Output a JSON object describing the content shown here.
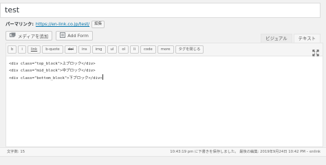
{
  "title": {
    "value": "test"
  },
  "permalink": {
    "label": "パーマリンク:",
    "url": "https://en-link.co.jp/test/",
    "edit_label": "編集"
  },
  "media": {
    "add_media_label": "メディアを追加",
    "add_form_label": "Add Form"
  },
  "tabs": [
    {
      "label": "ビジュアル"
    },
    {
      "label": "テキスト",
      "active": true
    }
  ],
  "quicktags": [
    {
      "label": "b"
    },
    {
      "label": "i"
    },
    {
      "label": "link"
    },
    {
      "label": "b-quote"
    },
    {
      "label": "del"
    },
    {
      "label": "ins"
    },
    {
      "label": "img"
    },
    {
      "label": "ul"
    },
    {
      "label": "ol"
    },
    {
      "label": "li"
    },
    {
      "label": "code"
    },
    {
      "label": "more"
    },
    {
      "label": "タグを閉じる"
    }
  ],
  "content": {
    "lines": [
      "<div class=\"top_block\">上ブロック</div>",
      "<div class=\"mid_block\">中ブロック</div>",
      "<div class=\"bottom_block\">下ブロック</div>"
    ]
  },
  "status": {
    "word_count": "文字数: 15",
    "saved_text": "10:43:19 pm に下書きを保存しました。 最後の編集: 2019年9月24日 10:42 PM – enlink"
  },
  "colors": {
    "link": "#0073aa",
    "background": "#f1f1f1"
  }
}
